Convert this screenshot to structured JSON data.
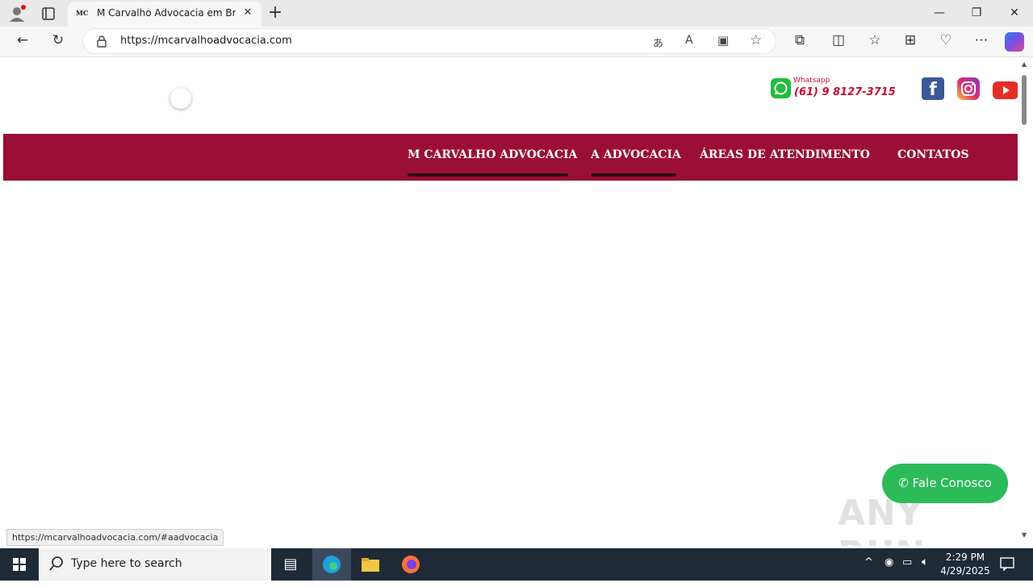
{
  "browser": {
    "tab": {
      "favicon_text": "MC",
      "title": "M Carvalho Advocacia em Brasília"
    },
    "address": {
      "url": "https://mcarvalhoadvocacia.com"
    },
    "status_url": "https://mcarvalhoadvocacia.com/#aadvocacia"
  },
  "site": {
    "whatsapp": {
      "label": "Whatsapp",
      "phone": "(61) 9 8127-3715"
    },
    "nav": [
      {
        "label": "M CARVALHO ADVOCACIA"
      },
      {
        "label": "A ADVOCACIA"
      },
      {
        "label": "ÁREAS DE ATENDIMENTO"
      },
      {
        "label": "CONTATOS"
      }
    ],
    "fale_conosco": "Fale Conosco",
    "brand_color": "#9b0e36",
    "accent_green": "#2bbb59"
  },
  "watermark": "ANY RUN",
  "taskbar": {
    "search_placeholder": "Type here to search",
    "time": "2:29 PM",
    "date": "4/29/2025"
  }
}
